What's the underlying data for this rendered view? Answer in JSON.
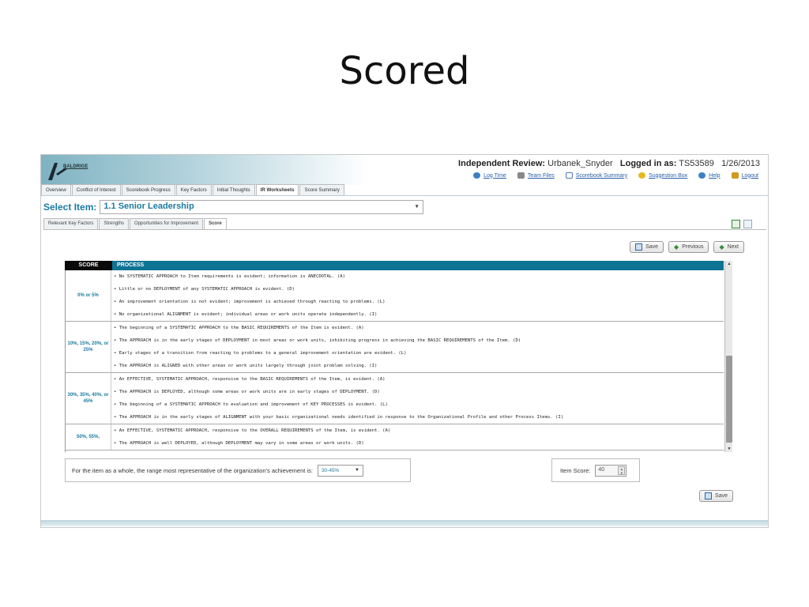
{
  "slide": {
    "title": "Scored"
  },
  "header": {
    "logo_text": "BALDRIGE",
    "review_label": "Independent Review:",
    "reviewer": "Urbanek_Snyder",
    "logged_label": "Logged in as:",
    "user": "TS53589",
    "date": "1/26/2013",
    "links": [
      {
        "label": "Log Time",
        "icon": "clock-icon",
        "color": "#3b7fc4"
      },
      {
        "label": "Team Files",
        "icon": "files-icon",
        "color": "#888888"
      },
      {
        "label": "Scorebook Summary",
        "icon": "summary-icon",
        "color": "#4a7ab8"
      },
      {
        "label": "Suggestion Box",
        "icon": "lightbulb-icon",
        "color": "#e8b820"
      },
      {
        "label": "Help",
        "icon": "help-icon",
        "color": "#3b7fc4"
      },
      {
        "label": "Logout",
        "icon": "logout-icon",
        "color": "#d09a20"
      }
    ]
  },
  "tabs": [
    "Overview",
    "Conflict of Interest",
    "Scorebook Progress",
    "Key Factors",
    "Initial Thoughts",
    "IR Worksheets",
    "Score Summary"
  ],
  "active_tab": "IR Worksheets",
  "select": {
    "label": "Select Item:",
    "value": "1.1 Senior Leadership"
  },
  "subtabs": [
    "Relevant Key Factors",
    "Strengths",
    "Opportunities for Improvement",
    "Score"
  ],
  "active_subtab": "Score",
  "buttons": {
    "save": "Save",
    "previous": "Previous",
    "next": "Next"
  },
  "grid": {
    "col_score": "SCORE",
    "col_process": "PROCESS",
    "groups": [
      {
        "score": "0% or 5%",
        "rows": [
          "• No SYSTEMATIC APPROACH to Item requirements is evident; information is ANECDOTAL. (A)",
          "• Little or no DEPLOYMENT of any SYSTEMATIC APPROACH is evident. (D)",
          "• An improvement orientation is not evident; improvement is achieved through reacting to problems. (L)",
          "• No organizational ALIGNMENT is evident; individual areas or work units operate independently. (I)"
        ]
      },
      {
        "score": "10%, 15%, 20%, or 25%",
        "rows": [
          "• The beginning of a SYSTEMATIC APPROACH to the BASIC REQUIREMENTS of the Item is evident. (A)",
          "• The APPROACH is in the early stages of DEPLOYMENT in most areas or work units, inhibiting progress in achieving the BASIC REQUIREMENTS of the Item. (D)",
          "• Early stages of a transition from reacting to problems to a general improvement orientation are evident. (L)",
          "• The APPROACH is ALIGNED with other areas or work units largely through joint problem solving. (I)"
        ]
      },
      {
        "score": "30%, 35%, 40%, or 45%",
        "rows": [
          "• An EFFECTIVE, SYSTEMATIC APPROACH, responsive to the BASIC REQUIREMENTS of the Item, is evident. (A)",
          "• The APPROACH is DEPLOYED, although some areas or work units are in early stages of DEPLOYMENT. (D)",
          "• The beginning of a SYSTEMATIC APPROACH to evaluation and improvement of KEY PROCESSES is evident. (L)",
          "• The APPROACH is in the early stages of ALIGNMENT with your basic organizational needs identified in response to the Organizational Profile and other Process Items. (I)"
        ]
      },
      {
        "score": "50%, 55%,",
        "rows": [
          "• An EFFECTIVE, SYSTEMATIC APPROACH, responsive to the OVERALL REQUIREMENTS of the Item, is evident. (A)",
          "• The APPROACH is well DEPLOYED, although DEPLOYMENT may vary in some areas or work units. (D)"
        ]
      }
    ]
  },
  "footer": {
    "question": "For the item as a whole, the range most representative of the organization's achievement is:",
    "range_value": "30-45%",
    "item_score_label": "Item Score:",
    "item_score_value": "40",
    "save": "Save"
  }
}
